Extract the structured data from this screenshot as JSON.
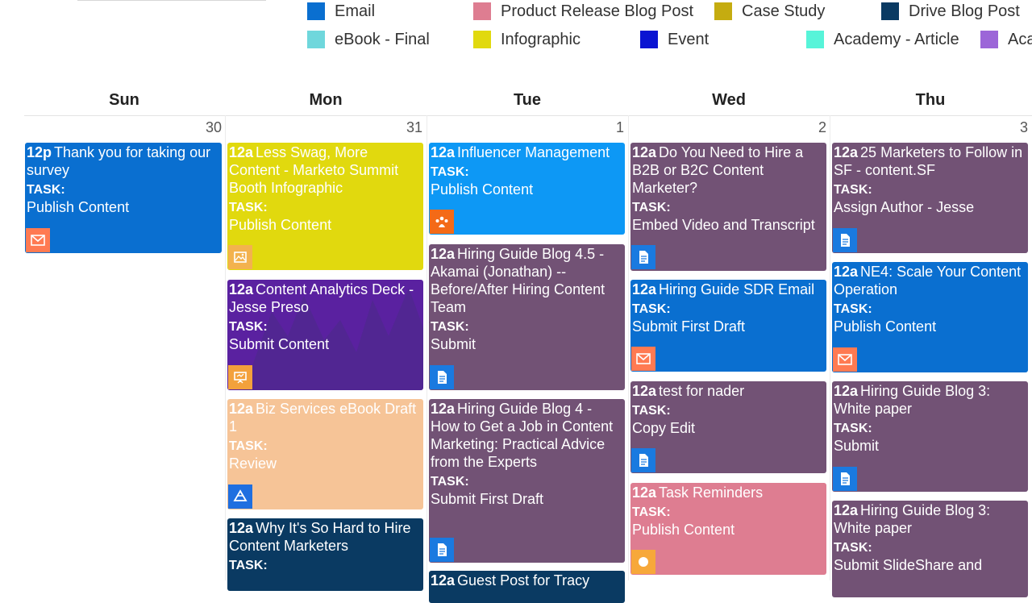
{
  "legend": [
    {
      "label": "Email",
      "color": "#0a6fd0"
    },
    {
      "label": "Product Release Blog Post",
      "color": "#de7d91"
    },
    {
      "label": "Case Study",
      "color": "#c5ac10"
    },
    {
      "label": "Drive Blog Post",
      "color": "#0a3a62"
    },
    {
      "label": "eBook - Final",
      "color": "#6fd7dc"
    },
    {
      "label": "Infographic",
      "color": "#e1d90e"
    },
    {
      "label": "Event",
      "color": "#0a14d2"
    },
    {
      "label": "Academy - Article",
      "color": "#57f4d9"
    },
    {
      "label": "Aca",
      "color": "#9c66d8"
    }
  ],
  "days": [
    {
      "name": "Sun",
      "date": "30"
    },
    {
      "name": "Mon",
      "date": "31"
    },
    {
      "name": "Tue",
      "date": "1"
    },
    {
      "name": "Wed",
      "date": "2"
    },
    {
      "name": "Thu",
      "date": "3"
    }
  ],
  "task_label": "TASK:",
  "events": {
    "sun1": {
      "time": "12p",
      "title": "Thank you for taking our survey",
      "task": "Publish Content",
      "color": "#0a6fd0",
      "icon": "email-icon"
    },
    "mon1": {
      "time": "12a",
      "title": "Less Swag, More Content - Marketo Summit Booth Infographic",
      "task": "Publish Content",
      "color": "#e1d90e",
      "icon": "image-icon"
    },
    "mon2": {
      "time": "12a",
      "title": "Content Analytics Deck - Jesse Preso",
      "task": "Submit Content",
      "color": "#5a21a0",
      "icon": "presentation-icon"
    },
    "mon3": {
      "time": "12a",
      "title": "Biz Services eBook Draft 1",
      "task": "Review",
      "color": "#f6c497",
      "icon": "drive-icon"
    },
    "mon4": {
      "time": "12a",
      "title": "Why It's So Hard to Hire Content Marketers",
      "task": "",
      "color": "#0a3a62",
      "icon": ""
    },
    "tue1": {
      "time": "12a",
      "title": "Influencer Management",
      "task": "Publish Content",
      "color": "#0d98f5",
      "icon": "people-icon"
    },
    "tue2": {
      "time": "12a",
      "title": "Hiring Guide Blog 4.5 - Akamai (Jonathan) -- Before/After Hiring Content Team",
      "task": "Submit",
      "color": "#725275",
      "icon": "document-icon"
    },
    "tue3": {
      "time": "12a",
      "title": "Hiring Guide Blog 4 - How to Get a Job in Content Marketing: Practical Advice from the Experts",
      "task": "Submit First Draft",
      "color": "#725275",
      "icon": "document-icon"
    },
    "tue4": {
      "time": "12a",
      "title": "Guest Post for Tracy",
      "task": "",
      "color": "#0a3a62",
      "icon": ""
    },
    "wed1": {
      "time": "12a",
      "title": "Do You Need to Hire a B2B or B2C Content Marketer?",
      "task": "Embed Video and Transcript",
      "color": "#725275",
      "icon": "document-icon"
    },
    "wed2": {
      "time": "12a",
      "title": "Hiring Guide SDR Email",
      "task": "Submit First Draft",
      "color": "#0a6fd0",
      "icon": "email-icon"
    },
    "wed3": {
      "time": "12a",
      "title": "test for nader",
      "task": "Copy Edit",
      "color": "#725275",
      "icon": "document-icon"
    },
    "wed4": {
      "time": "12a",
      "title": "Task Reminders",
      "task": "Publish Content",
      "color": "#de7d91",
      "icon": "circle-icon"
    },
    "thu1": {
      "time": "12a",
      "title": "25 Marketers to Follow in SF - content.SF",
      "task": "Assign Author - Jesse",
      "color": "#725275",
      "icon": "document-icon"
    },
    "thu2": {
      "time": "12a",
      "title": "NE4: Scale Your Content Operation",
      "task": "Publish Content",
      "color": "#0a6fd0",
      "icon": "email-icon"
    },
    "thu3": {
      "time": "12a",
      "title": "Hiring Guide Blog 3: White paper",
      "task": "Submit",
      "color": "#725275",
      "icon": "document-icon"
    },
    "thu4": {
      "time": "12a",
      "title": "Hiring Guide Blog 3: White paper",
      "task": "Submit SlideShare and",
      "color": "#725275",
      "icon": ""
    }
  }
}
